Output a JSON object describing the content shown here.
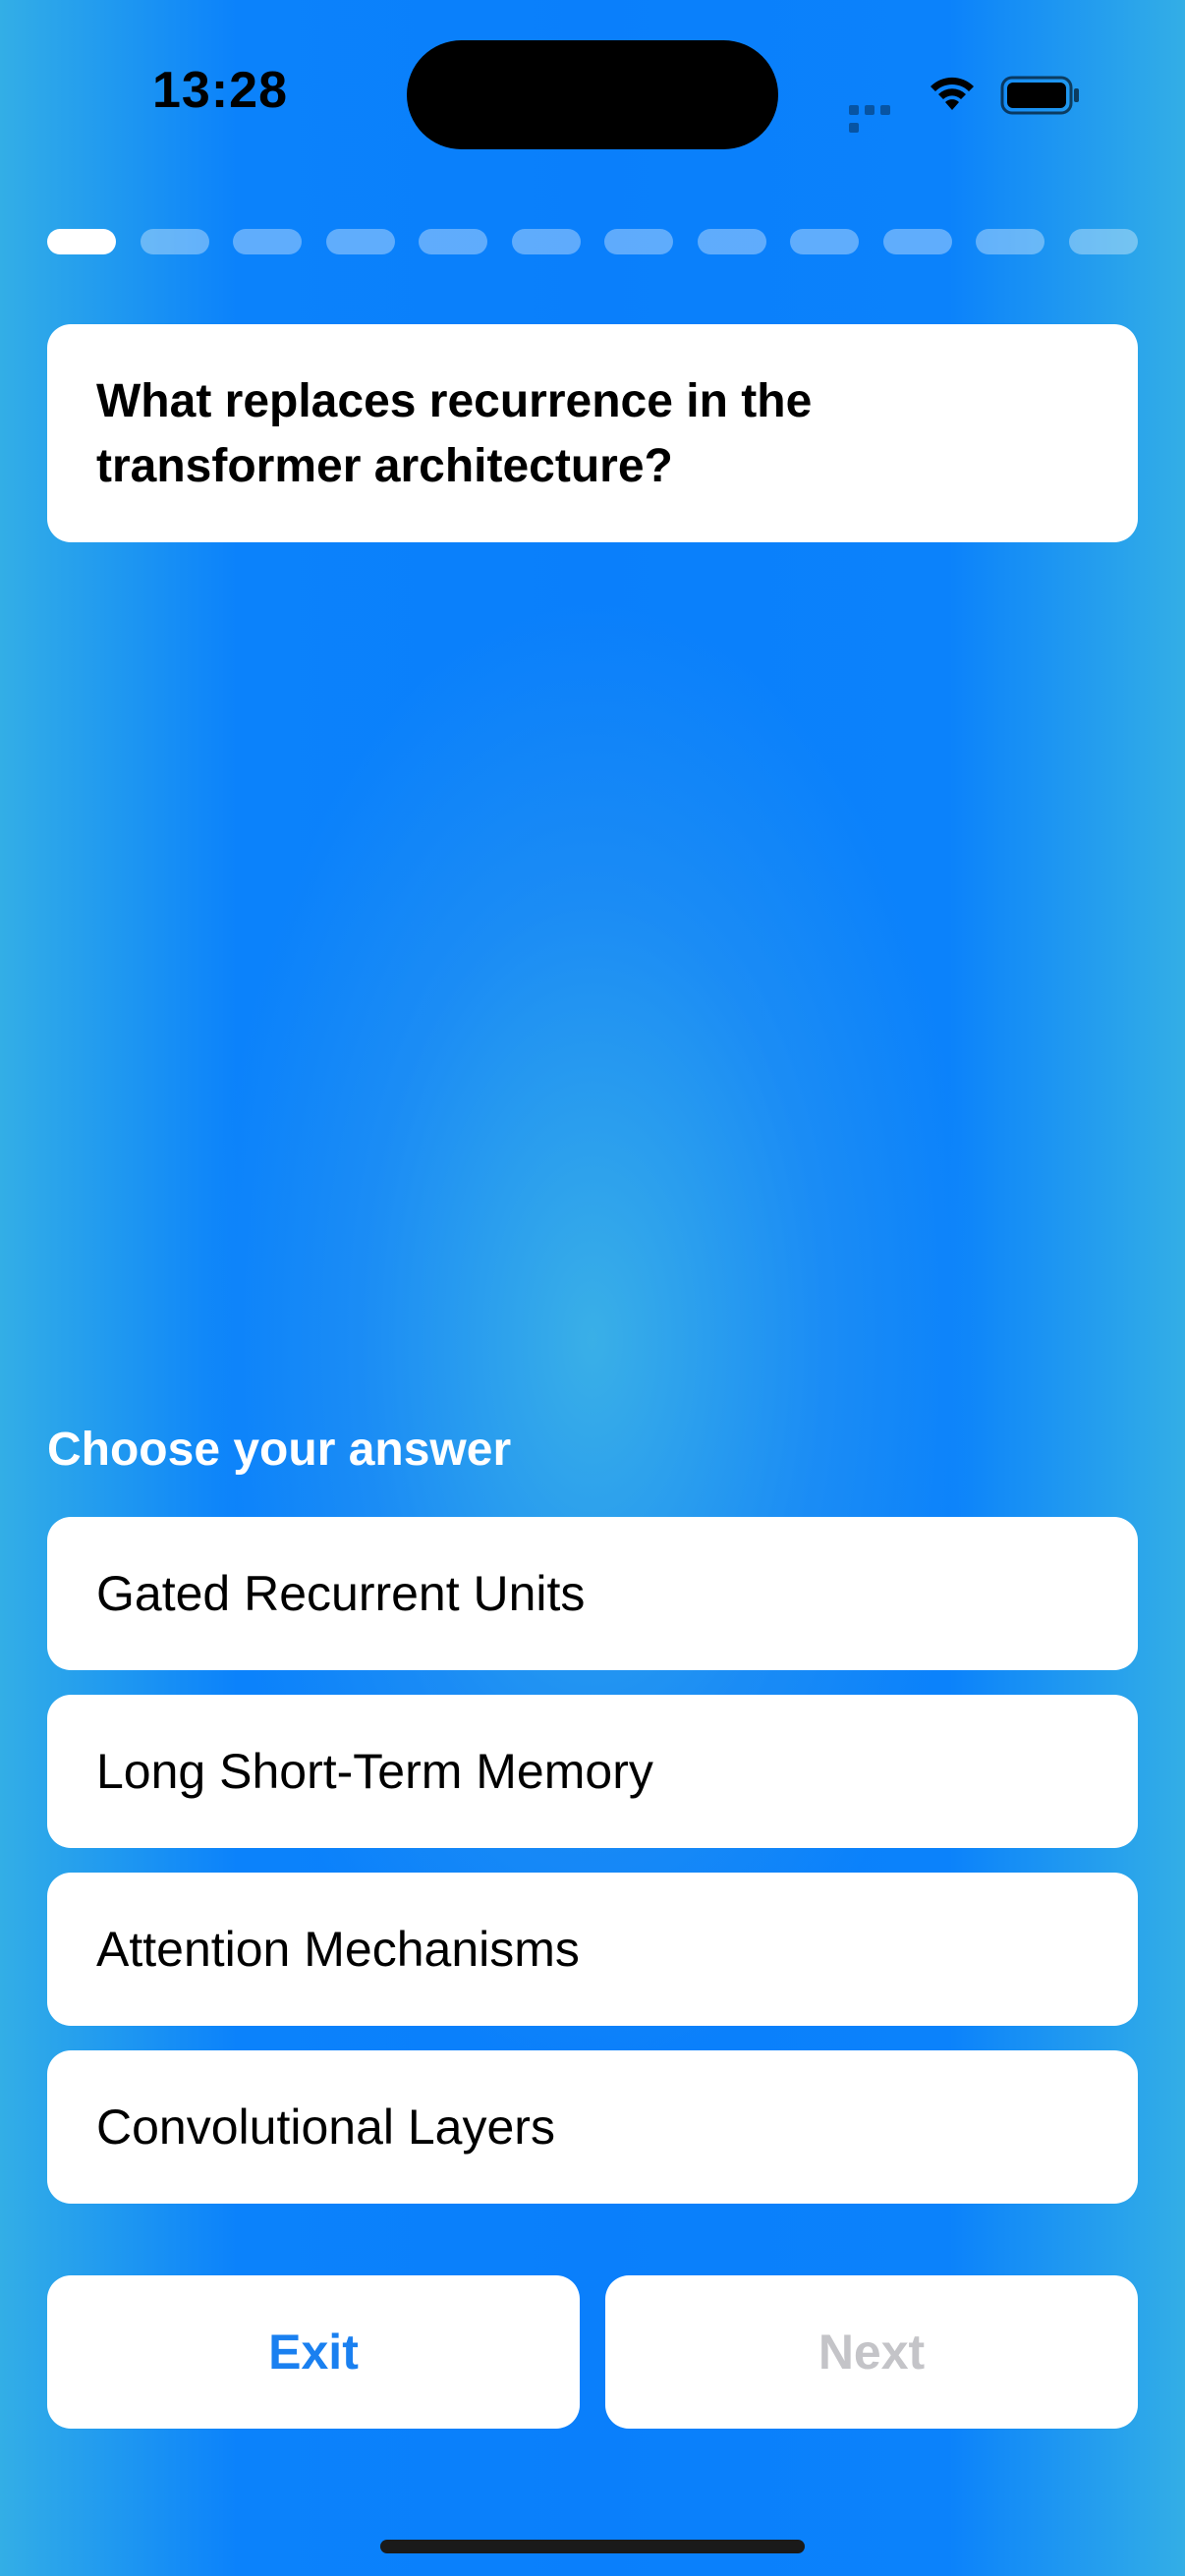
{
  "status_bar": {
    "time": "13:28",
    "icons": [
      "cellular-signal-icon",
      "wifi-icon",
      "battery-icon"
    ]
  },
  "progress": {
    "total_segments": 12,
    "current_index": 0
  },
  "question": {
    "text": "What replaces recurrence in the transformer architecture?"
  },
  "prompt": {
    "label": "Choose your answer"
  },
  "answers": [
    {
      "label": "Gated Recurrent Units"
    },
    {
      "label": "Long Short-Term Memory"
    },
    {
      "label": "Attention Mechanisms"
    },
    {
      "label": "Convolutional Layers"
    }
  ],
  "buttons": {
    "exit_label": "Exit",
    "next_label": "Next",
    "next_enabled": false
  },
  "colors": {
    "accent": "#1a80f0",
    "background_primary": "#0a7ffb",
    "background_secondary": "#33aee6",
    "disabled_text": "#c4c4c8"
  }
}
